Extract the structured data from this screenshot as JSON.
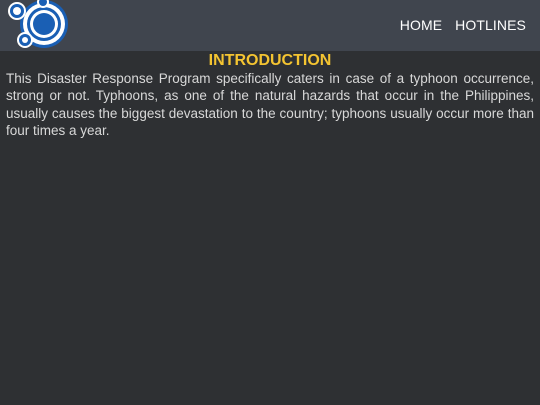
{
  "nav": {
    "links": [
      "HOME",
      "HOTLINES"
    ]
  },
  "main": {
    "title": "INTRODUCTION",
    "body": "This Disaster Response Program specifically caters in case of a typhoon occurrence, strong or not. Typhoons, as one of the natural hazards that occur in the Philippines, usually causes the biggest devastation to the country; typhoons usually occur more than four times a year."
  },
  "colors": {
    "navbar": "#40454e",
    "background": "#2e3033",
    "title": "#f4c431",
    "logo": "#1a5fb4"
  },
  "icons": {
    "logo": "circles-logo-icon"
  }
}
